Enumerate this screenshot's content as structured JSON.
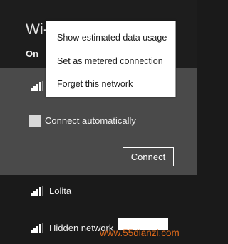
{
  "header": {
    "title": "Wi-",
    "toggle_state": "On"
  },
  "selected_network": {
    "connect_automatically_label": "Connect automatically",
    "connect_automatically_checked": false,
    "connect_button_label": "Connect"
  },
  "networks": [
    {
      "name": "Lolita"
    },
    {
      "name": "Hidden network"
    }
  ],
  "context_menu": {
    "items": [
      {
        "label": "Show estimated data usage"
      },
      {
        "label": "Set as metered connection"
      },
      {
        "label": "Forget this network"
      }
    ]
  },
  "watermark": {
    "text": "www.55dianzi.com"
  },
  "colors": {
    "panel_background": "#1a1a1a",
    "selected_background": "#4a4a4a",
    "menu_background": "#ffffff",
    "watermark_color": "#e06a1b"
  },
  "icons": {
    "signal": "wifi-signal-icon"
  }
}
